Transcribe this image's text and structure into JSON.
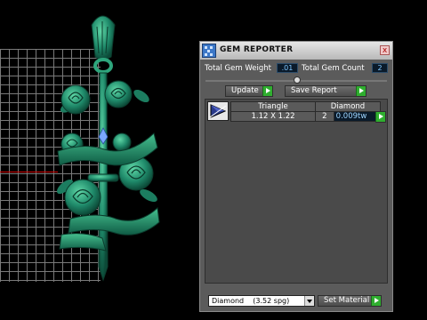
{
  "dialog": {
    "title": "GEM REPORTER",
    "close_glyph": "x",
    "total_weight_label": "Total Gem Weight",
    "total_weight_value": ".01",
    "total_count_label": "Total Gem Count",
    "total_count_value": "2",
    "update_label": "Update",
    "save_report_label": "Save Report",
    "table": {
      "headers": [
        "Triangle",
        "Diamond"
      ],
      "row": {
        "size": "1.12 X 1.22",
        "count": "2",
        "weight": "0.009tw"
      }
    },
    "material_select": {
      "selected": "Diamond    (3.52 spg)"
    },
    "set_material_label": "Set Material"
  },
  "colors": {
    "model": "#1f8a6a",
    "dialog_bg": "#5b5b5b",
    "go_button": "#2fae2f",
    "value_text": "#7fc7ff"
  },
  "icons": [
    "gem-reporter-app-icon",
    "close-icon",
    "play-arrow-icon",
    "triangle-gem-icon",
    "dropdown-arrow-icon"
  ]
}
